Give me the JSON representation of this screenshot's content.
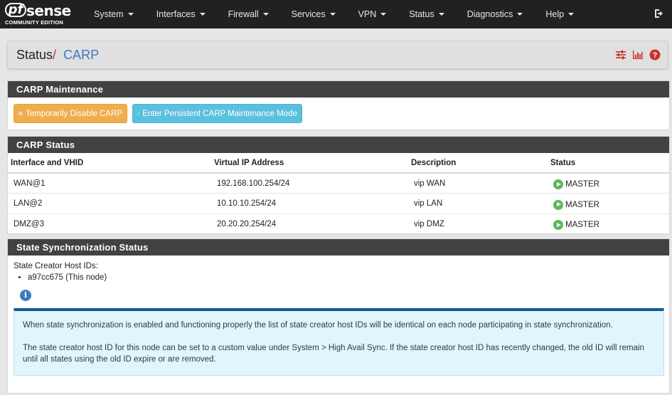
{
  "brand": {
    "logo_pf": "pf",
    "logo_sense": "sense",
    "edition": "COMMUNITY EDITION"
  },
  "nav": {
    "items": [
      "System",
      "Interfaces",
      "Firewall",
      "Services",
      "VPN",
      "Status",
      "Diagnostics",
      "Help"
    ]
  },
  "breadcrumb": {
    "parent": "Status",
    "separator": "/",
    "current": "CARP"
  },
  "maintenance": {
    "title": "CARP Maintenance",
    "disable_label": "Temporarily Disable CARP",
    "persistent_label": "Enter Persistent CARP Maintenance Mode"
  },
  "carp_status": {
    "title": "CARP Status",
    "columns": [
      "Interface and VHID",
      "Virtual IP Address",
      "Description",
      "Status"
    ],
    "rows": [
      {
        "iface": "WAN@1",
        "vip": "192.168.100.254/24",
        "desc": "vip WAN",
        "status": "MASTER"
      },
      {
        "iface": "LAN@2",
        "vip": "10.10.10.254/24",
        "desc": "vip LAN",
        "status": "MASTER"
      },
      {
        "iface": "DMZ@3",
        "vip": "20.20.20.254/24",
        "desc": "vip DMZ",
        "status": "MASTER"
      }
    ]
  },
  "sync": {
    "title": "State Synchronization Status",
    "host_ids_label": "State Creator Host IDs:",
    "host_ids": [
      "a97cc675 (This node)"
    ],
    "info_glyph": "i",
    "alert_p1": "When state synchronization is enabled and functioning properly the list of state creator host IDs will be identical on each node participating in state synchronization.",
    "alert_p2": "The state creator host ID for this node can be set to a custom value under System > High Avail Sync. If the state creator host ID has recently changed, the old ID will remain until all states using the old ID expire or are removed."
  },
  "colors": {
    "navbar": "#212121",
    "panel_heading": "#424242",
    "warning": "#f0ad4e",
    "info": "#5bc0de",
    "success": "#5cb85c",
    "link": "#3b7bbf",
    "danger": "#c9302c"
  }
}
